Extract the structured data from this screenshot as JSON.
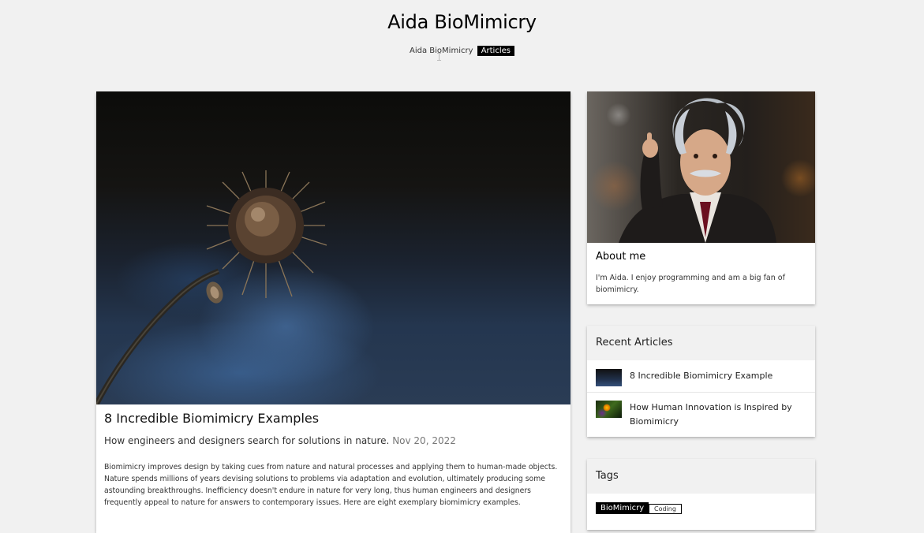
{
  "site": {
    "title": "Aida BioMimicry"
  },
  "nav": {
    "home": "Aida BioMimicry",
    "articles": "Articles"
  },
  "main_article": {
    "title": "8 Incredible Biomimicry Examples",
    "subtitle": "How engineers and designers search for solutions in nature.",
    "date": "Nov 20, 2022",
    "body": "Biomimicry improves design by taking cues from nature and natural processes and applying them to human-made objects. Nature spends millions of years devising solutions to problems via adaptation and evolution, ultimately producing some astounding breakthroughs. Inefficiency doesn't endure in nature for very long, thus human engineers and designers frequently appeal to nature for answers to contemporary issues. Here are eight exemplary biomimicry examples."
  },
  "about": {
    "title": "About me",
    "text": "I'm Aida. I enjoy programming and am a big fan of biomimicry."
  },
  "recent": {
    "heading": "Recent Articles",
    "items": [
      {
        "label": "8 Incredible Biomimicry Example"
      },
      {
        "label": "How Human Innovation is Inspired by Biomimicry"
      }
    ]
  },
  "tags": {
    "heading": "Tags",
    "items": [
      "BioMimicry",
      "Coding"
    ]
  }
}
